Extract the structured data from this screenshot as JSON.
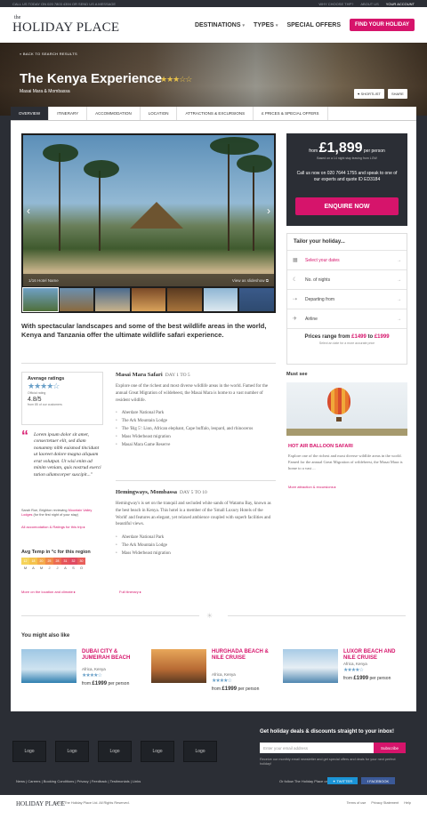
{
  "topbar": {
    "call": "CALL US TODAY ON 020 7803 4394 OR SEND US A MESSAGE",
    "why": "WHY CHOOSE THP?",
    "about": "ABOUT US",
    "account": "YOUR ACCOUNT"
  },
  "header": {
    "logo_the": "the",
    "logo_main": "HOLIDAY PLACE",
    "nav": [
      "DESTINATIONS",
      "TYPES",
      "SPECIAL OFFERS"
    ],
    "cta": "FIND YOUR HOLIDAY"
  },
  "hero": {
    "back": "« BACK TO SEARCH RESULTS",
    "title": "The Kenya Experience",
    "stars": "★★★☆☆",
    "subtitle": "Masai Mara & Mombassa",
    "shortlist": "♥ SHORTLIST",
    "share": "SHARE"
  },
  "tabs": [
    "OVERVIEW",
    "ITINERARY",
    "ACCOMMODATION",
    "LOCATION",
    "ATTRACTIONS & EXCURSIONS",
    "£ PRICES & SPECIAL OFFERS"
  ],
  "gallery": {
    "caption": "1/16  Hotel Name",
    "slideshow": "View as slideshow"
  },
  "booking": {
    "from": "from",
    "price": "£1,899",
    "per": "per person",
    "based": "Based on a 14 night stay leaving from LGW",
    "call_text": "Call us now on 020 7644 1755 and speak to one of our experts and quote ID ED3184",
    "enquire": "ENQUIRE NOW"
  },
  "tailor": {
    "title": "Tailor your holiday...",
    "rows": [
      {
        "icon": "▦",
        "label": "Select your dates"
      },
      {
        "icon": "☾",
        "label": "No. of nights"
      },
      {
        "icon": "⇢",
        "label": "Departing from"
      },
      {
        "icon": "✈",
        "label": "Airline"
      }
    ],
    "range_label": "Prices range from",
    "range_from": "£1499",
    "range_to": "£1999",
    "range_note": "Select an date for a more accurate price"
  },
  "intro": "With spectacular landscapes and some of the best wildlife areas in the world, Kenya and Tanzania offer the ultimate wildlife safari experience.",
  "ratings": {
    "title": "Average ratings",
    "stars": "★★★★☆",
    "official": "Official rating",
    "score": "4.8/5",
    "customers": "from 85 of our customers"
  },
  "quote": "Lorem ipsum dolor sit amet, consectetuer elit, sed diam nonummy nibh euismod tincidunt ut laoreet dolore magna aliquam erat volutpat. Ut wisi enim ad minim veniam, quis nostrud exerci tation ullamcorper suscipit...\"",
  "reviewer": {
    "name": "Sarah Roe, Brighton reviewing",
    "place": "Mountain Valley Lodges",
    "note": "(for the first night of your stay)"
  },
  "all_acc": "All accomodation & Ratings for this trip ▸",
  "temp": {
    "title": "Avg Temp in °c for this region",
    "values": [
      "12",
      "18",
      "20",
      "25",
      "28",
      "31",
      "32",
      "30"
    ],
    "colors": [
      "#f5d35a",
      "#f4c24d",
      "#f4a94a",
      "#f08a4a",
      "#ec6d52",
      "#e6555a",
      "#e04b61",
      "#e85f5a"
    ],
    "months": [
      "M",
      "A",
      "M",
      "J",
      "J",
      "A",
      "S",
      "O"
    ],
    "more": "More on the location and climate ▸"
  },
  "itinerary": [
    {
      "title": "Masai Mara Safari",
      "days": "DAY 1 TO 5",
      "text": "Explore one of the richest and most diverse wildlife areas in the world. Famed for the annual Great Migration of wildebeest, the Masai Mara is home to a vast number of resident wildlife.",
      "items": [
        "Aberdare National Park",
        "The Ark Mountain Lodge",
        "The 'Big 5': Lion, African elephant, Cape buffalo, leopard, and rhinoceros",
        "Mass Widerbeast migration",
        "Masai Mara Game Reserve"
      ]
    },
    {
      "title": "Hemingways, Mombassa",
      "days": "DAY 5 TO 10",
      "text": "Hemingway's is set on the tranquil and secluded white sands of Watamu Bay, known as the best beach in Kenya. This hotel is a member of the 'Small Luxury Hotels of the World' and features an elegant, yet relaxed ambience coupled with superb facilities and beautiful views.",
      "items": [
        "Aberdare National Park",
        "The Ark Mountain Lodge",
        "Mass Widerbeast migration"
      ]
    }
  ],
  "full_itinerary": "Full itinerary ▸",
  "must_see": {
    "title": "Must see",
    "name": "HOT AIR BALLOON SAFARI",
    "text": "Explore one of the richest and most diverse wildlife areas in the world. Famed for the annual Great Migration of wildebeest, the Masai Mara is home to a vast ...",
    "more": "More attraction & excursions ▸"
  },
  "also_like": {
    "title": "You might also like",
    "items": [
      {
        "name": "DUBAI CITY & JUMEIRAH BEACH",
        "loc": "Africa, Kenya",
        "stars": "★★★★☆",
        "from": "from",
        "price": "£1999",
        "per": "per person"
      },
      {
        "name": "HURGHADA BEACH & NILE CRUISE",
        "loc": "Africa, Kenya",
        "stars": "★★★★☆",
        "from": "from",
        "price": "£1999",
        "per": "per person"
      },
      {
        "name": "LUXOR BEACH AND NILE CRUISE",
        "loc": "Africa, Kenya",
        "stars": "★★★★☆",
        "from": "from",
        "price": "£1999",
        "per": "per person"
      }
    ]
  },
  "footer": {
    "logos": [
      "Logo",
      "Logo",
      "Logo",
      "Logo",
      "Logo"
    ],
    "deals": "Get holiday deals & discounts straight to your inbox!",
    "email_placeholder": "Enter your email address",
    "subscribe": "Subscribe",
    "note": "Receive our monthly email newsletter and get special offers and deals for your next perfect holiday!",
    "links": "News | Careers | Booking Conditions | Privacy | Feedback | Testimonials | Links",
    "follow": "Or follow The Holiday Place on",
    "twitter": "TWITTER",
    "facebook": "FACEBOOK"
  },
  "bottom": {
    "logo": "HOLIDAY PLACE",
    "copyright": "©2012 The Holiday Place Ltd. All Rights Reserved.",
    "links": [
      "Terms of use",
      "Privacy Statement",
      "Help"
    ]
  }
}
